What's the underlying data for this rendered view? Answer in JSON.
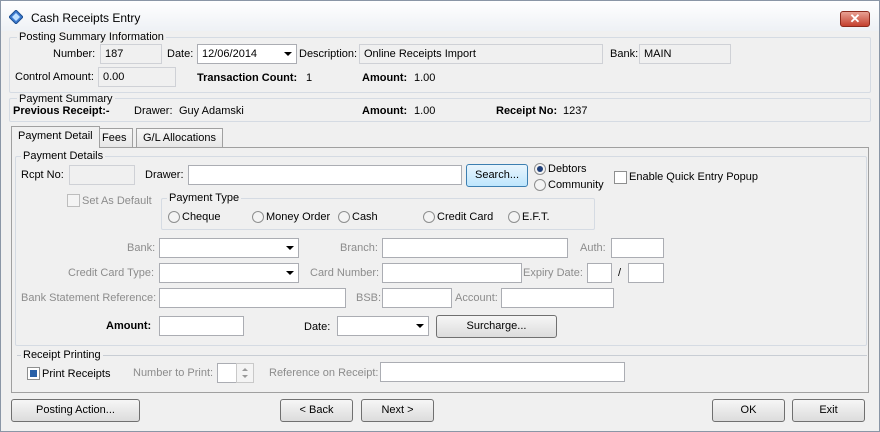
{
  "window": {
    "title": "Cash Receipts Entry",
    "close_glyph": "✕"
  },
  "posting_summary": {
    "group_title": "Posting Summary Information",
    "number_label": "Number:",
    "number_value": "187",
    "date_label": "Date:",
    "date_value": "12/06/2014",
    "description_label": "Description:",
    "description_value": "Online Receipts Import",
    "bank_label": "Bank:",
    "bank_value": "MAIN",
    "control_amount_label": "Control Amount:",
    "control_amount_value": "0.00",
    "transaction_count_label": "Transaction Count:",
    "transaction_count_value": "1",
    "amount_label": "Amount:",
    "amount_value": "1.00"
  },
  "payment_summary": {
    "group_title": "Payment Summary",
    "previous_receipt_label": "Previous Receipt:-",
    "drawer_label": "Drawer:",
    "drawer_value": "Guy Adamski",
    "amount_label": "Amount:",
    "amount_value": "1.00",
    "receipt_no_label": "Receipt No:",
    "receipt_no_value": "1237"
  },
  "tabs": [
    {
      "label": "Payment Detail",
      "active": true
    },
    {
      "label": "Fees",
      "active": false
    },
    {
      "label": "G/L Allocations",
      "active": false
    }
  ],
  "payment_details": {
    "group_title": "Payment Details",
    "rcpt_no_label": "Rcpt No:",
    "rcpt_no_value": "",
    "drawer_label": "Drawer:",
    "drawer_value": "",
    "search_button": "Search...",
    "debtors_label": "Debtors",
    "community_label": "Community",
    "enable_quick_entry_label": "Enable Quick Entry Popup",
    "set_as_default_label": "Set As Default",
    "payment_type": {
      "group_title": "Payment Type",
      "options": [
        "Cheque",
        "Money Order",
        "Cash",
        "Credit Card",
        "E.F.T."
      ]
    },
    "bank_label": "Bank:",
    "branch_label": "Branch:",
    "auth_label": "Auth:",
    "credit_card_type_label": "Credit Card Type:",
    "card_number_label": "Card Number:",
    "expiry_date_label": "Expiry Date:",
    "expiry_sep": "/",
    "bank_statement_reference_label": "Bank Statement Reference:",
    "bsb_label": "BSB:",
    "account_label": "Account:",
    "amount_label": "Amount:",
    "amount_value": "",
    "date_label": "Date:",
    "date_value": "",
    "surcharge_button": "Surcharge..."
  },
  "receipt_printing": {
    "group_title": "Receipt Printing",
    "print_receipts_label": "Print Receipts",
    "number_to_print_label": "Number to Print:",
    "reference_on_receipt_label": "Reference on Receipt:"
  },
  "footer": {
    "posting_action": "Posting Action...",
    "back": "< Back",
    "next": "Next >",
    "ok": "OK",
    "exit": "Exit"
  }
}
